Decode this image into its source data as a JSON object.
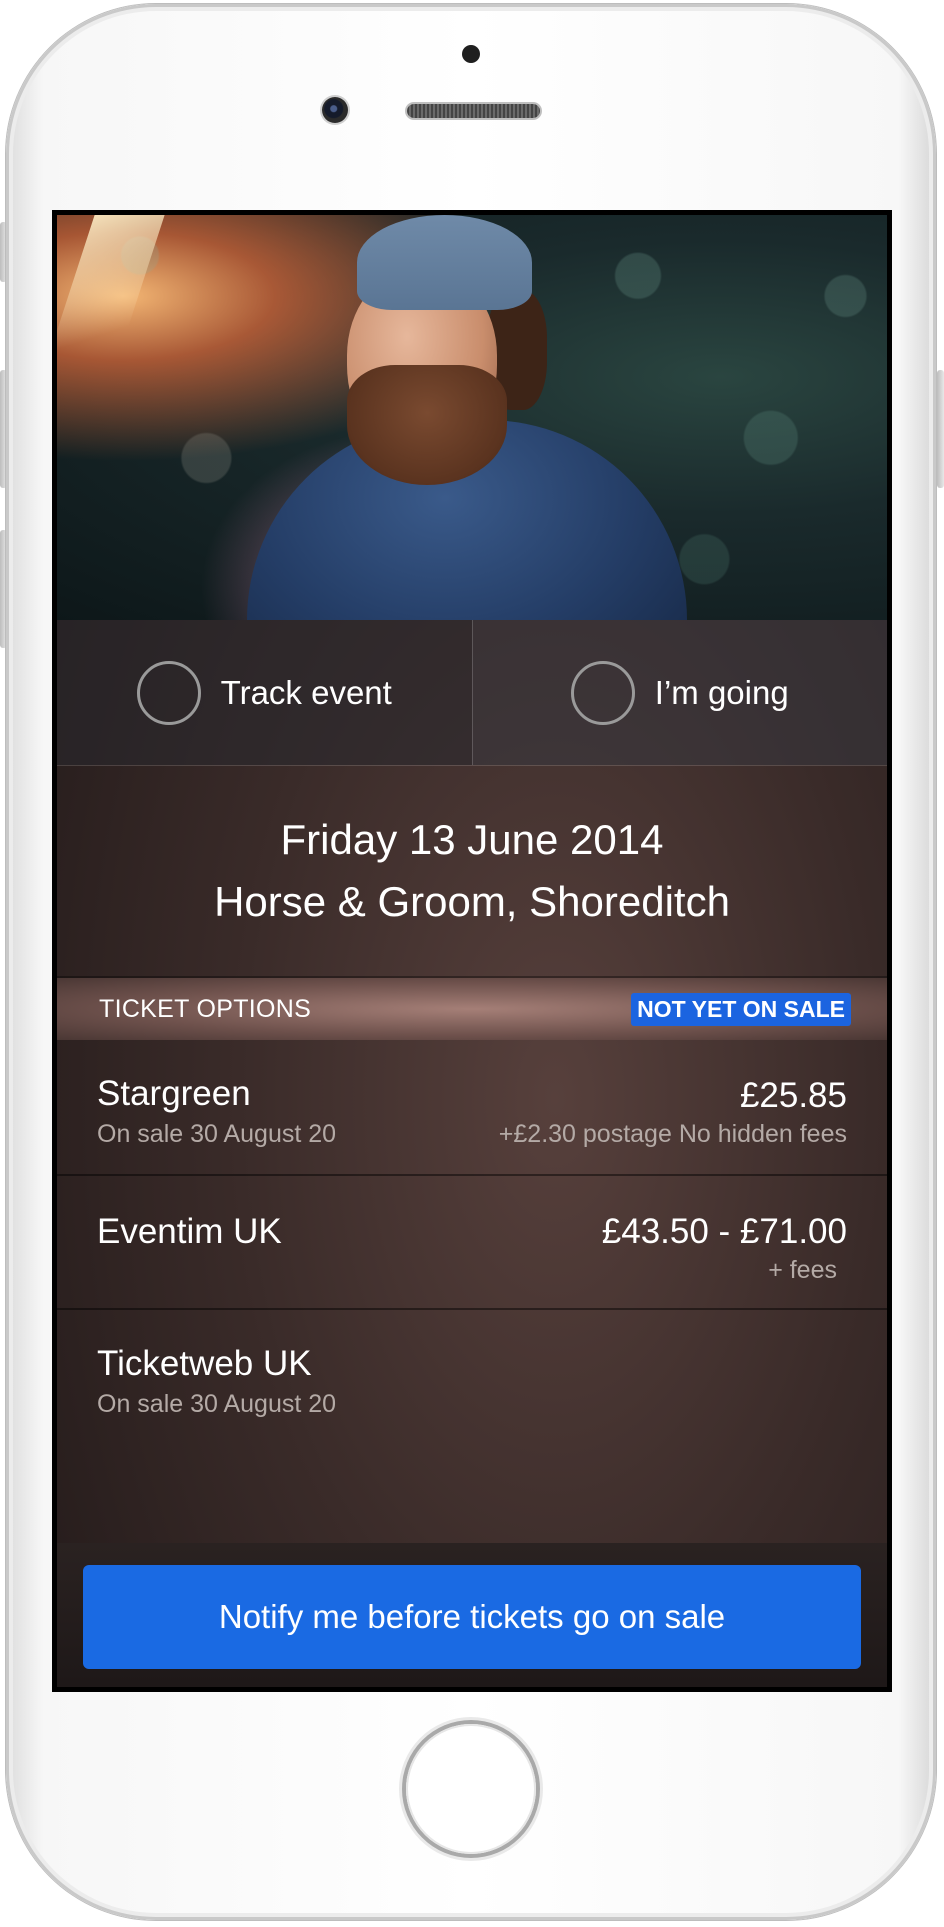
{
  "actions": {
    "track_label": "Track event",
    "going_label": "I’m going"
  },
  "event": {
    "date": "Friday 13 June 2014",
    "venue": "Horse & Groom, Shoreditch"
  },
  "ticket_options": {
    "title": "TICKET OPTIONS",
    "status_badge": "NOT YET ON SALE",
    "badge_color": "#1b64e0",
    "vendors": [
      {
        "name": "Stargreen",
        "sale_info": "On sale 30 August 20",
        "price": "£25.85",
        "fees": "+£2.30 postage No hidden fees"
      },
      {
        "name": "Eventim UK",
        "sale_info": "",
        "price": "£43.50 - £71.00",
        "fees": "+ fees"
      },
      {
        "name": "Ticketweb UK",
        "sale_info": "On sale 30 August 20",
        "price": "",
        "fees": ""
      }
    ]
  },
  "cta": {
    "label": "Notify me before tickets go on sale",
    "color": "#1a6ae3"
  }
}
